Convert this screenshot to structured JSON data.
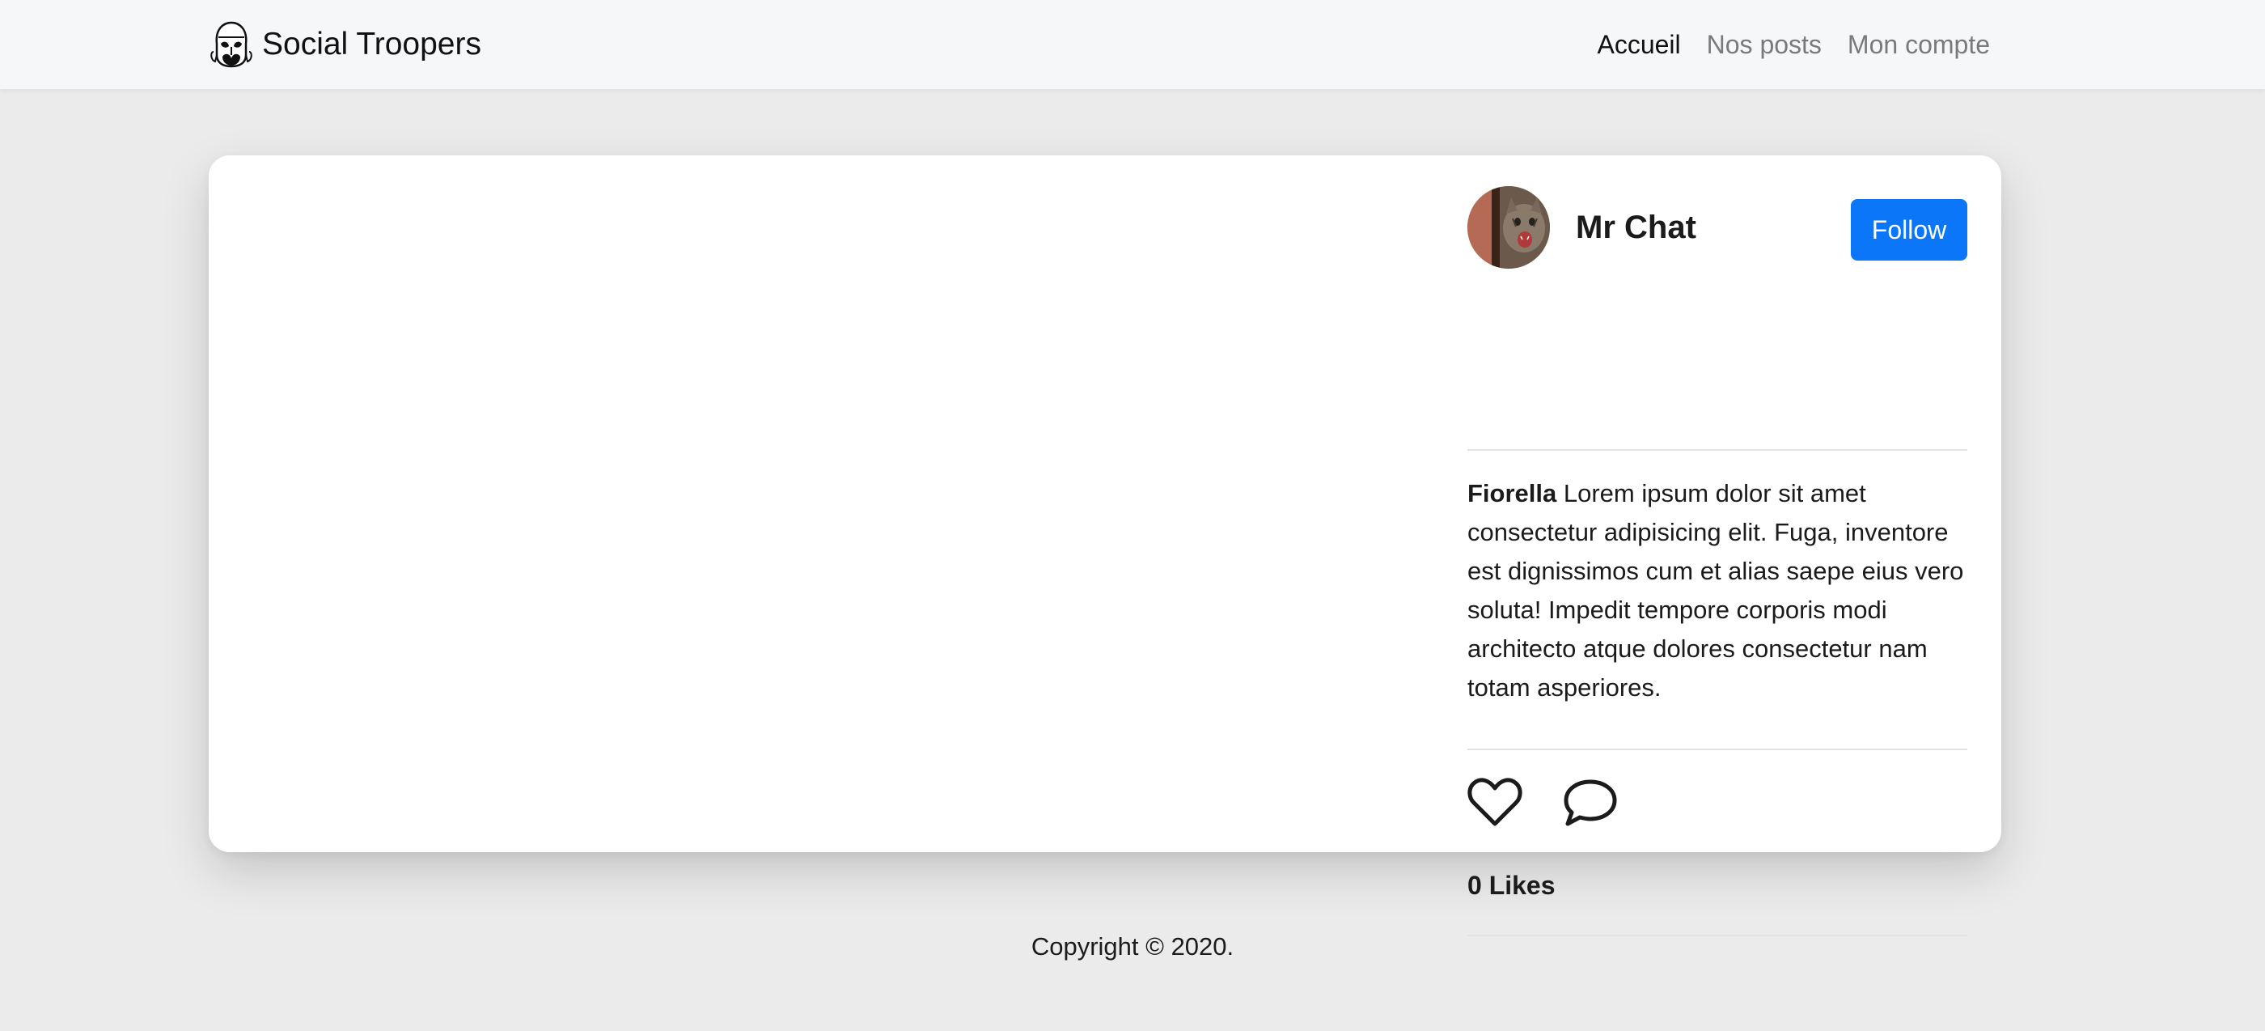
{
  "navbar": {
    "brand": "Social Troopers",
    "links": [
      {
        "label": "Accueil",
        "active": true
      },
      {
        "label": "Nos posts",
        "active": false
      },
      {
        "label": "Mon compte",
        "active": false
      }
    ]
  },
  "post": {
    "author": "Mr Chat",
    "follow_label": "Follow",
    "caption_user": "Fiorella",
    "caption_text": " Lorem ipsum dolor sit amet consectetur adipisicing elit. Fuga, inventore est dignissimos cum et alias saepe eius vero soluta! Impedit tempore corporis modi architecto atque dolores consectetur nam totam asperiores.",
    "likes": "0 Likes",
    "icons": [
      "heart-icon",
      "comment-icon"
    ]
  },
  "footer": {
    "copyright": "Copyright © 2020."
  },
  "colors": {
    "follow_button": "#0b76f7",
    "page_background": "#ebebeb",
    "navbar_background": "#f6f7f9"
  }
}
